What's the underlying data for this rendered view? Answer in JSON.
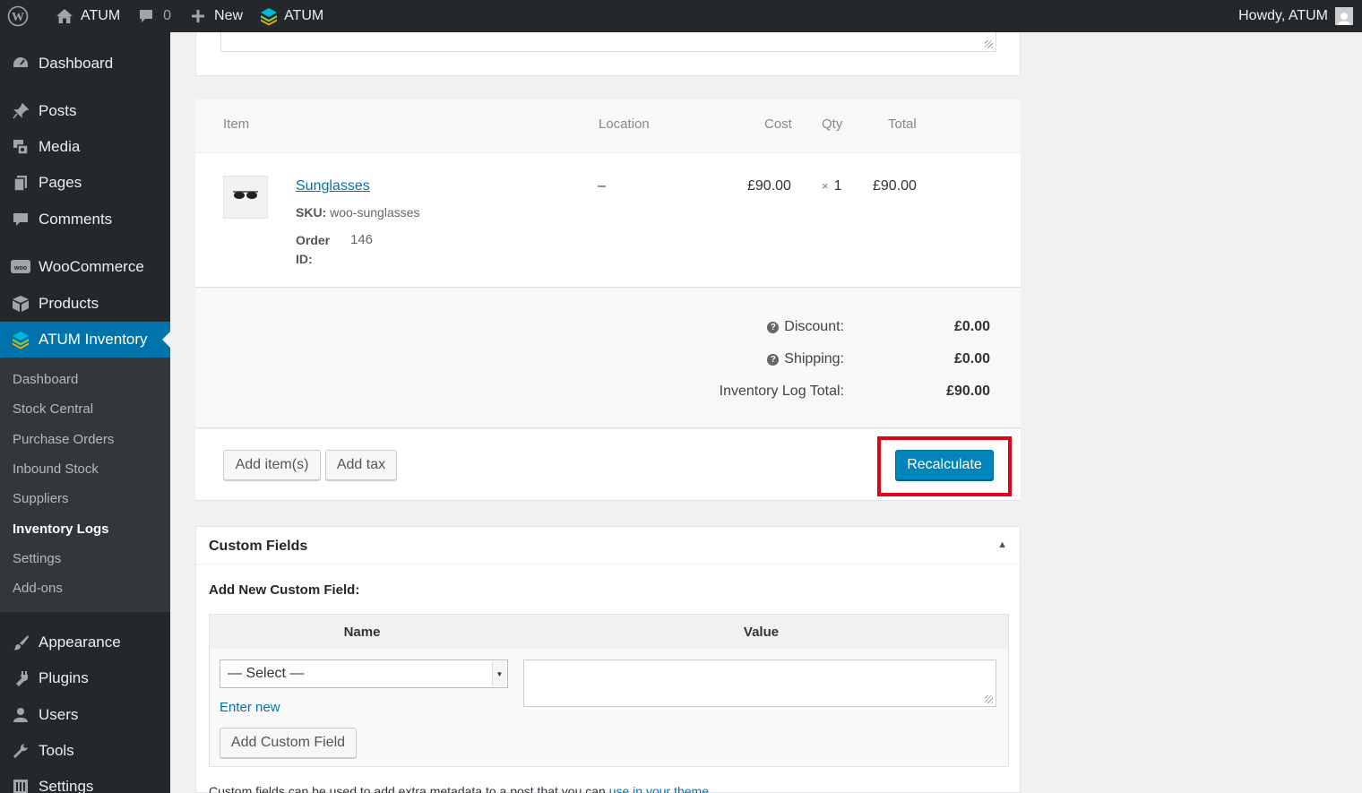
{
  "admin_bar": {
    "site_name": "ATUM",
    "comments_count": "0",
    "new_label": "New",
    "plugin_label": "ATUM",
    "greeting": "Howdy, ATUM"
  },
  "sidebar": {
    "items": [
      {
        "label": "Dashboard",
        "icon": "dashboard-icon"
      },
      {
        "label": "Posts",
        "icon": "pushpin-icon"
      },
      {
        "label": "Media",
        "icon": "media-icon"
      },
      {
        "label": "Pages",
        "icon": "pages-icon"
      },
      {
        "label": "Comments",
        "icon": "comment-icon"
      },
      {
        "label": "WooCommerce",
        "icon": "woo-icon"
      },
      {
        "label": "Products",
        "icon": "box-icon"
      },
      {
        "label": "ATUM Inventory",
        "icon": "atum-icon"
      },
      {
        "label": "Appearance",
        "icon": "brush-icon"
      },
      {
        "label": "Plugins",
        "icon": "plug-icon"
      },
      {
        "label": "Users",
        "icon": "user-icon"
      },
      {
        "label": "Tools",
        "icon": "wrench-icon"
      },
      {
        "label": "Settings",
        "icon": "settings-icon"
      }
    ],
    "submenu": [
      {
        "label": "Dashboard"
      },
      {
        "label": "Stock Central"
      },
      {
        "label": "Purchase Orders"
      },
      {
        "label": "Inbound Stock"
      },
      {
        "label": "Suppliers"
      },
      {
        "label": "Inventory Logs"
      },
      {
        "label": "Settings"
      },
      {
        "label": "Add-ons"
      }
    ]
  },
  "items_table": {
    "headers": {
      "item": "Item",
      "location": "Location",
      "cost": "Cost",
      "qty": "Qty",
      "total": "Total"
    },
    "row": {
      "name": "Sunglasses",
      "sku_label": "SKU:",
      "sku": "woo-sunglasses",
      "order_id_label_1": "Order",
      "order_id_label_2": "ID:",
      "order_id": "146",
      "location": "–",
      "cost": "£90.00",
      "qty_prefix": "×",
      "qty": "1",
      "total": "£90.00"
    }
  },
  "totals": {
    "discount_label": "Discount:",
    "discount": "£0.00",
    "shipping_label": "Shipping:",
    "shipping": "£0.00",
    "log_total_label": "Inventory Log Total:",
    "log_total": "£90.00"
  },
  "actions": {
    "add_items": "Add item(s)",
    "add_tax": "Add tax",
    "recalculate": "Recalculate"
  },
  "custom_fields": {
    "title": "Custom Fields",
    "subtitle": "Add New Custom Field:",
    "name_header": "Name",
    "value_header": "Value",
    "select_value": "— Select —",
    "enter_new": "Enter new",
    "add_button": "Add Custom Field",
    "note_text": "Custom fields can be used to add extra metadata to a post that you can ",
    "note_link": "use in your theme"
  },
  "colors": {
    "admin_dark": "#23282d",
    "accent": "#0073aa",
    "primary_button": "#0085ba",
    "highlight_box": "#e3001b"
  }
}
